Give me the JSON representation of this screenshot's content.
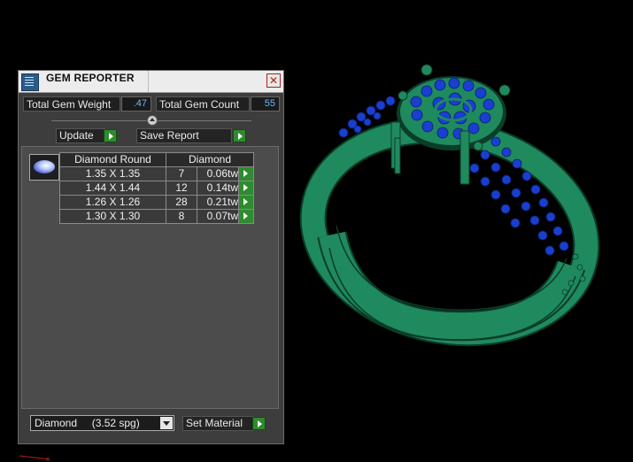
{
  "panel": {
    "title": "GEM REPORTER",
    "close_glyph": "✕",
    "total_weight_label": "Total Gem Weight",
    "total_weight_value": ".47",
    "total_count_label": "Total Gem Count",
    "total_count_value": "55",
    "update_label": "Update",
    "save_report_label": "Save Report",
    "table": {
      "headers": [
        "Diamond Round",
        "Diamond"
      ],
      "rows": [
        {
          "size": "1.35 X 1.35",
          "count": "7",
          "tw": "0.06tw"
        },
        {
          "size": "1.44 X 1.44",
          "count": "12",
          "tw": "0.14tw"
        },
        {
          "size": "1.26 X 1.26",
          "count": "28",
          "tw": "0.21tw"
        },
        {
          "size": "1.30 X 1.30",
          "count": "8",
          "tw": "0.07tw"
        }
      ]
    },
    "material_selected": "Diamond     (3.52 spg)",
    "set_material_label": "Set Material"
  },
  "colors": {
    "metal": "#1f8a5e",
    "metal_edge": "#0b3d28",
    "gem": "#1a3fd0",
    "go_button": "#2e8b2e",
    "value_text": "#6ab8ff"
  },
  "icons": {
    "app": "gem-reporter-app-icon",
    "close": "close-icon",
    "go": "play-arrow-icon",
    "thumb": "round-diamond-icon"
  }
}
